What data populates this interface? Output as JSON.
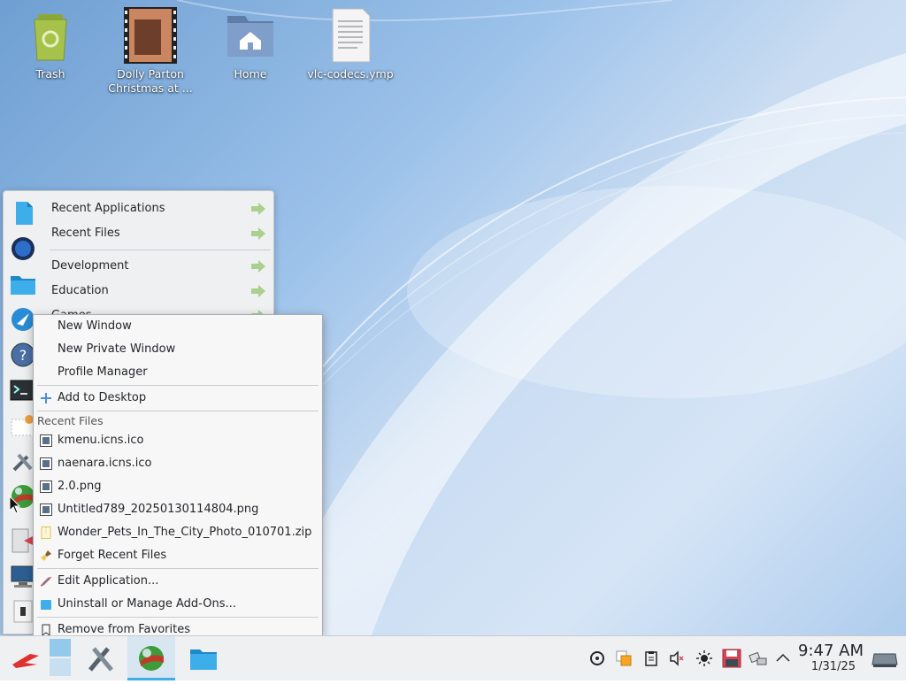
{
  "desktop": {
    "icons": [
      {
        "label": "Trash"
      },
      {
        "label": "Dolly Parton Christmas at ..."
      },
      {
        "label": "Home"
      },
      {
        "label": "vlc-codecs.ymp"
      }
    ]
  },
  "kickoff": {
    "categories": [
      {
        "label": "Recent Applications"
      },
      {
        "label": "Recent Files"
      },
      {
        "label": "Development"
      },
      {
        "label": "Education"
      },
      {
        "label": "Games"
      }
    ]
  },
  "context_menu": {
    "actions": [
      {
        "label": "New Window"
      },
      {
        "label": "New Private Window"
      },
      {
        "label": "Profile Manager"
      }
    ],
    "add_to_desktop": "Add to Desktop",
    "recent_header": "Recent Files",
    "recent_files": [
      {
        "label": "kmenu.icns.ico"
      },
      {
        "label": "naenara.icns.ico"
      },
      {
        "label": "2.0.png"
      },
      {
        "label": "Untitled789_20250130114804.png"
      },
      {
        "label": "Wonder_Pets_In_The_City_Photo_010701.zip"
      }
    ],
    "forget_recent": "Forget Recent Files",
    "edit_application": "Edit Application...",
    "uninstall": "Uninstall or Manage Add-Ons...",
    "remove_favorites": "Remove from Favorites"
  },
  "taskbar": {
    "clock_time": "9:47 AM",
    "clock_date": "1/31/25"
  },
  "colors": {
    "accent": "#3daee9",
    "panel": "#eff0f1"
  }
}
